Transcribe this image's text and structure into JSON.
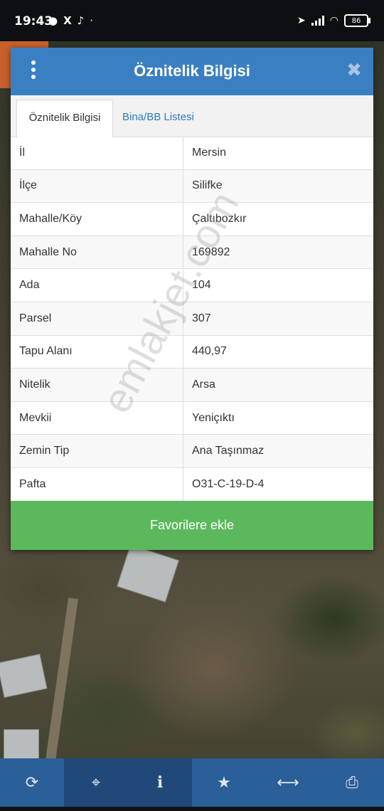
{
  "status_bar": {
    "time": "19:43",
    "battery": "86"
  },
  "dialog": {
    "title": "Öznitelik Bilgisi",
    "close_symbol": "✖",
    "tabs": [
      {
        "label": "Öznitelik Bilgisi",
        "active": true
      },
      {
        "label": "Bina/BB Listesi",
        "active": false
      }
    ],
    "rows": [
      {
        "key": "İl",
        "value": "Mersin"
      },
      {
        "key": "İlçe",
        "value": "Silifke"
      },
      {
        "key": "Mahalle/Köy",
        "value": "Çaltıbozkır"
      },
      {
        "key": "Mahalle No",
        "value": "169892"
      },
      {
        "key": "Ada",
        "value": "104"
      },
      {
        "key": "Parsel",
        "value": "307"
      },
      {
        "key": "Tapu Alanı",
        "value": "440,97"
      },
      {
        "key": "Nitelik",
        "value": "Arsa"
      },
      {
        "key": "Mevkii",
        "value": "Yeniçıktı"
      },
      {
        "key": "Zemin Tip",
        "value": "Ana Taşınmaz"
      },
      {
        "key": "Pafta",
        "value": "O31-C-19-D-4"
      }
    ],
    "favorite_button": "Favorilere ekle"
  },
  "watermark": "emlakjet.com",
  "toolbar": {
    "buttons": [
      {
        "icon": "refresh-icon",
        "glyph": "⟳"
      },
      {
        "icon": "locate-icon",
        "glyph": "⌖"
      },
      {
        "icon": "info-icon",
        "glyph": "i"
      },
      {
        "icon": "star-icon",
        "glyph": "★"
      },
      {
        "icon": "measure-icon",
        "glyph": "⟷"
      },
      {
        "icon": "print-icon",
        "glyph": "⎙"
      }
    ]
  },
  "colors": {
    "header": "#3b7fc3",
    "favorite": "#5cb85c",
    "toolbar": "#2b5f97",
    "tab_link": "#2f7ab8"
  }
}
